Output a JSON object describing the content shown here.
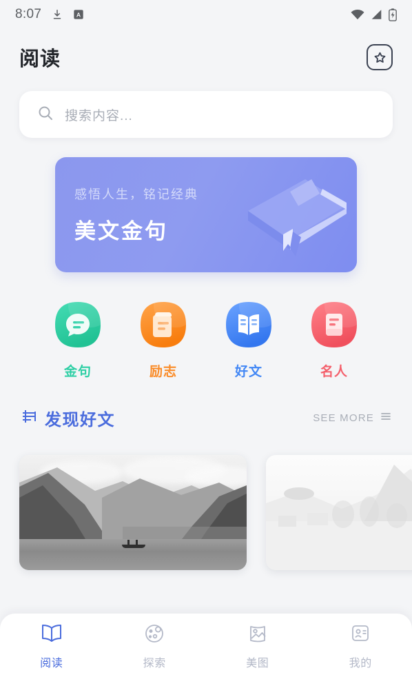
{
  "statusbar": {
    "time": "8:07",
    "left_icons": [
      "download-icon",
      "app-badge-a-icon"
    ],
    "right_icons": [
      "wifi-icon",
      "cellular-signal-icon",
      "battery-charging-icon"
    ]
  },
  "header": {
    "title": "阅读",
    "bookmark_icon": "star-square-icon"
  },
  "search": {
    "placeholder": "搜索内容...",
    "icon": "search-icon"
  },
  "banner": {
    "subtitle": "感悟人生，铭记经典",
    "title": "美文金句",
    "illustration": "book-3d-illustration",
    "gradient_from": "#8b97ee",
    "gradient_to": "#7e8df0"
  },
  "categories": [
    {
      "label": "金句",
      "icon": "speech-bubble-icon",
      "color": "#2ecfa5",
      "color_2": "#45dcb4",
      "text_color": "#2ecfa5"
    },
    {
      "label": "励志",
      "icon": "notebook-icon",
      "color": "#fa8c29",
      "color_2": "#ffa44a",
      "text_color": "#fa8c29"
    },
    {
      "label": "好文",
      "icon": "open-book-icon",
      "color": "#4287f5",
      "color_2": "#6ba3ff",
      "text_color": "#4287f5"
    },
    {
      "label": "名人",
      "icon": "document-card-icon",
      "color": "#f45f6b",
      "color_2": "#ff8189",
      "text_color": "#f45f6b"
    }
  ],
  "section": {
    "title": "发现好文",
    "leading_icon": "stacked-pages-icon",
    "see_more_label": "SEE MORE",
    "see_more_icon": "hamburger-icon",
    "accent_color": "#4a6cdd"
  },
  "articles": [
    {
      "name": "lake-mountain-photo",
      "alt": "黑白湖泊山峦小船"
    },
    {
      "name": "woman-mountain-photo",
      "alt": "浅灰女子侧影山景"
    }
  ],
  "bottom_nav": {
    "items": [
      {
        "label": "阅读",
        "icon": "open-book-icon",
        "active": true
      },
      {
        "label": "探索",
        "icon": "compass-planet-icon",
        "active": false
      },
      {
        "label": "美图",
        "icon": "image-landscape-icon",
        "active": false
      },
      {
        "label": "我的",
        "icon": "profile-card-icon",
        "active": false
      }
    ],
    "active_color": "#4a6cdd",
    "idle_color": "#b4b9c8"
  }
}
